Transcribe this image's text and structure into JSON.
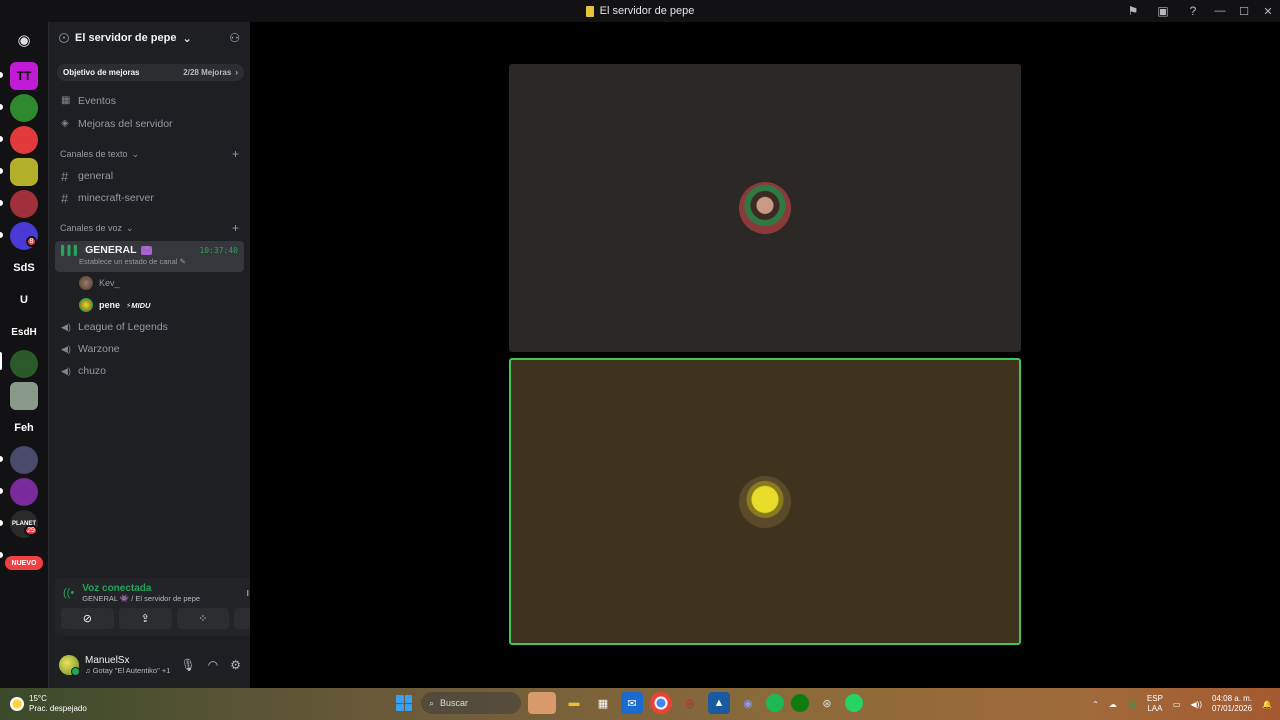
{
  "window": {
    "title": "El servidor de pepe",
    "icons": [
      "flag-icon",
      "inbox-icon",
      "help-icon"
    ]
  },
  "rail": {
    "servers": [
      {
        "name": "discord-home",
        "label": "",
        "color": "#121214"
      },
      {
        "name": "server-tt",
        "label": "TT",
        "color": "#c21bd6"
      },
      {
        "name": "server-2",
        "label": "",
        "color": "#2f8a2f"
      },
      {
        "name": "server-3",
        "label": "",
        "color": "#e23a3a"
      },
      {
        "name": "server-4",
        "label": "",
        "color": "#b5b02a"
      },
      {
        "name": "server-5",
        "label": "",
        "color": "#a0303a"
      },
      {
        "name": "server-6",
        "label": "",
        "color": "#4a3ad6"
      },
      {
        "name": "server-sds",
        "label": "SdS",
        "color": "#121214"
      },
      {
        "name": "server-u",
        "label": "U",
        "color": "#121214"
      },
      {
        "name": "server-esdh",
        "label": "EsdH",
        "color": "#121214"
      },
      {
        "name": "server-7",
        "label": "",
        "color": "#2a5a2a"
      },
      {
        "name": "server-8",
        "label": "",
        "color": "#8a9a8a"
      },
      {
        "name": "server-feh",
        "label": "Feh",
        "color": "#121214"
      },
      {
        "name": "server-9",
        "label": "",
        "color": "#4a4a6a"
      },
      {
        "name": "server-10",
        "label": "",
        "color": "#7a2a9a"
      },
      {
        "name": "server-planet",
        "label": "PLANET",
        "color": "#2a2a2a"
      }
    ],
    "badge_1": "8",
    "badge_2": "29",
    "new_label": "NUEVO"
  },
  "sidebar": {
    "server_name": "El servidor de pepe",
    "boost": {
      "goal": "Objetivo de mejoras",
      "progress": "2/28 Mejoras"
    },
    "menu": [
      {
        "label": "Eventos",
        "icon": "calendar-icon"
      },
      {
        "label": "Mejoras del servidor",
        "icon": "boost-icon"
      }
    ],
    "text_category": "Canales de texto",
    "text_channels": [
      "general",
      "minecraft-server"
    ],
    "voice_category": "Canales de voz",
    "active_voice": {
      "name": "GENERAL",
      "time": "10:37:40",
      "status": "Establece un estado de canal",
      "emoji": "👾"
    },
    "members": [
      {
        "name": "Kev_",
        "tag": "",
        "color": "#949ba4"
      },
      {
        "name": "pene",
        "tag": "⚡MIDU",
        "color": "#f2f3f5"
      }
    ],
    "voice_channels": [
      "League of Legends",
      "Warzone",
      "chuzo"
    ]
  },
  "voice_panel": {
    "status": "Voz conectada",
    "channel": "GENERAL 👾 / El servidor de pepe"
  },
  "user": {
    "name": "ManuelSx",
    "status": "♫ Gotay \"El Autentiko\" +1"
  },
  "taskbar": {
    "temp": "15°C",
    "weather": "Prac. despejado",
    "search_placeholder": "Buscar",
    "lang_1": "ESP",
    "lang_2": "LAA",
    "time": "04:08 a. m.",
    "date": "07/01/2026"
  },
  "colors": {
    "accent_green": "#23a55a",
    "speaking_border": "#3cc95a"
  }
}
